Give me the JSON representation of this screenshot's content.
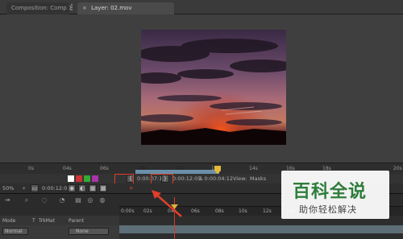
{
  "tabs": {
    "composition": "Composition: Comp 1",
    "layer": "Layer: 02.mov"
  },
  "ruler": {
    "ticks": [
      "0s",
      "04s",
      "06s",
      "08s",
      "10s",
      "12s",
      "14s",
      "16s",
      "18s",
      "20s"
    ]
  },
  "viewer_controls": {
    "current_time": "0:00:07:19",
    "out_time": "0:00:12:05",
    "duration": "Δ 0:00:04:12",
    "view_label": "View:",
    "view_value": "Masks",
    "zoom": "50%",
    "time_display": "0:00:12:05"
  },
  "timeline": {
    "ticks": [
      "0:00s",
      "02s",
      "04s",
      "06s",
      "08s",
      "10s",
      "12s",
      "14s"
    ],
    "columns": {
      "mode": "Mode",
      "t": "T",
      "trkmat": "TrkMat",
      "parent": "Parent"
    },
    "layer": {
      "mode": "Normal",
      "parent": "None"
    }
  },
  "watermark": {
    "title": "百科全说",
    "subtitle": "助你轻松解决"
  },
  "colors": {
    "highlight": "#e0402a",
    "marker": "#e3b93a",
    "watermark_green": "#2d7d3a"
  }
}
